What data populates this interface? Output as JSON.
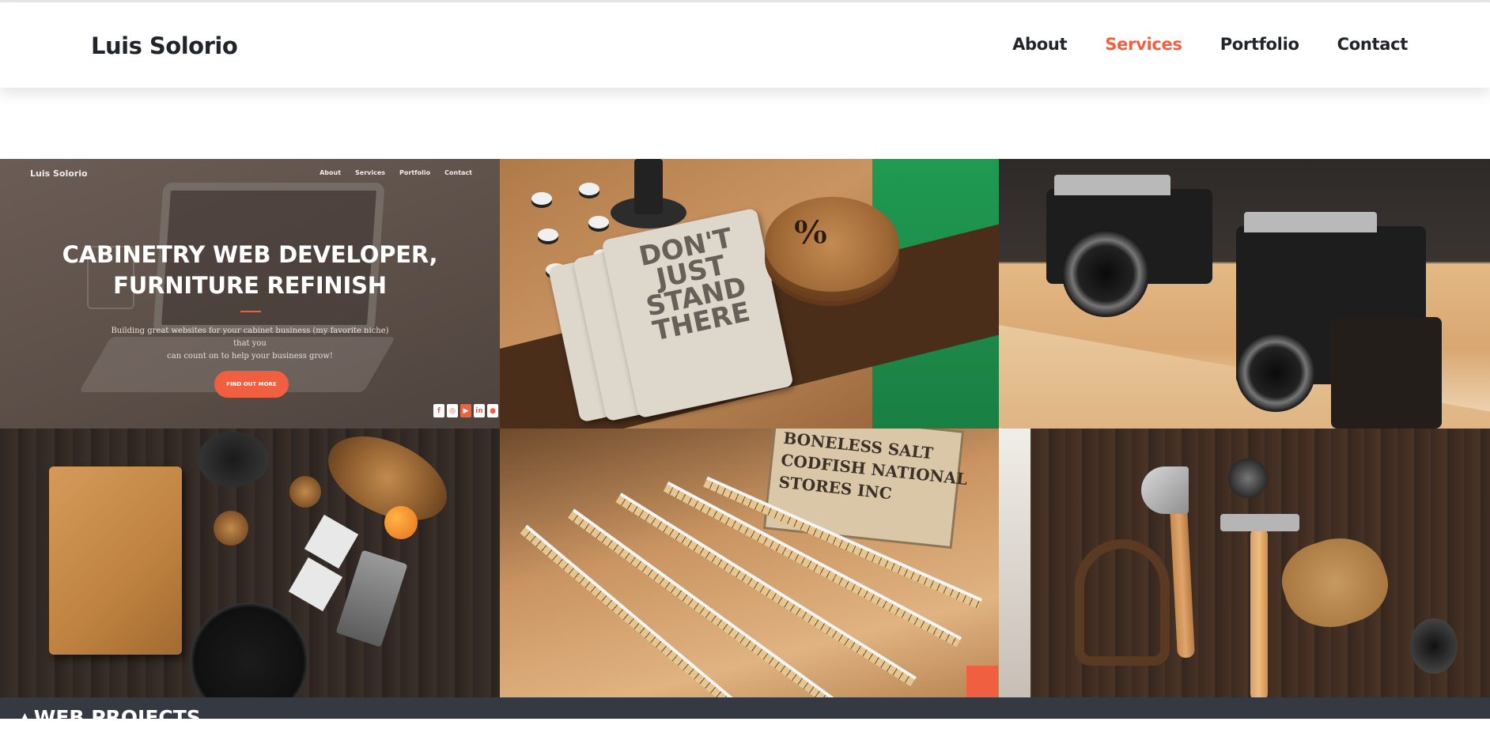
{
  "site": {
    "brand": "Luis Solorio",
    "nav": [
      {
        "label": "About",
        "active": false
      },
      {
        "label": "Services",
        "active": true
      },
      {
        "label": "Portfolio",
        "active": false
      },
      {
        "label": "Contact",
        "active": false
      }
    ],
    "accent_color": "#f05f40"
  },
  "portfolio": {
    "tiles": [
      {
        "kind": "website-preview",
        "preview": {
          "brand": "Luis Solorio",
          "nav": [
            "About",
            "Services",
            "Portfolio",
            "Contact"
          ],
          "title_line1": "CABINETRY WEB DEVELOPER,",
          "title_line2": "FURNITURE REFINISH",
          "subtitle_line1": "Building great websites for your cabinet business (my favorite niche) that you",
          "subtitle_line2": "can count on to help your business grow!",
          "button": "FIND OUT MORE",
          "social_icons": [
            "facebook-icon",
            "instagram-icon",
            "youtube-icon",
            "linkedin-icon",
            "github-icon"
          ]
        }
      },
      {
        "kind": "photo",
        "subject": "notebooks",
        "notebook_text": "DON'T JUST STAND THERE"
      },
      {
        "kind": "photo",
        "subject": "cameras"
      },
      {
        "kind": "photo",
        "subject": "kitchen"
      },
      {
        "kind": "photo",
        "subject": "rulers",
        "box_text": "BONELESS SALT CODFISH NATIONAL STORES INC"
      },
      {
        "kind": "photo",
        "subject": "tools"
      }
    ]
  },
  "section": {
    "title": "WEB PROJECTS",
    "caret_icon": "caret-up-icon"
  }
}
